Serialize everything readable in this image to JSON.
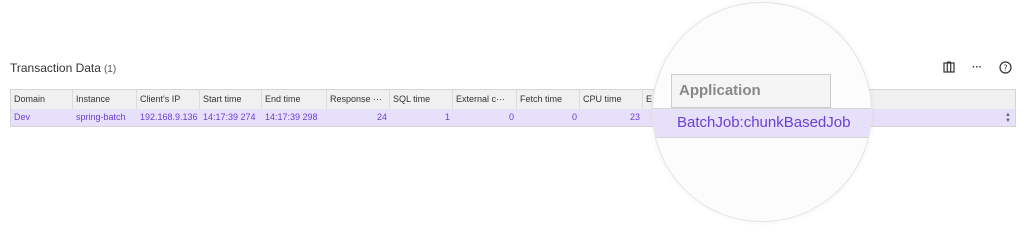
{
  "panel": {
    "title": "Transaction Data",
    "count": "(1)"
  },
  "toolbar": {
    "icons": [
      "columns-icon",
      "more-icon",
      "help-icon"
    ],
    "more_glyph": "···",
    "help_glyph": "?"
  },
  "table": {
    "columns": [
      "Domain",
      "Instance",
      "Client's IP",
      "Start time",
      "End time",
      "Response ···",
      "SQL time",
      "External c···",
      "Fetch time",
      "CPU time",
      "E"
    ],
    "row": [
      "Dev",
      "spring-batch",
      "192.168.9.136",
      "14:17:39 274",
      "14:17:39 298",
      "24",
      "1",
      "0",
      "0",
      "23"
    ]
  },
  "magnifier": {
    "header": "Application",
    "value": "BatchJob:chunkBasedJob"
  },
  "colors": {
    "row_highlight": "#e7e0fb",
    "row_text": "#6a3fd6"
  }
}
